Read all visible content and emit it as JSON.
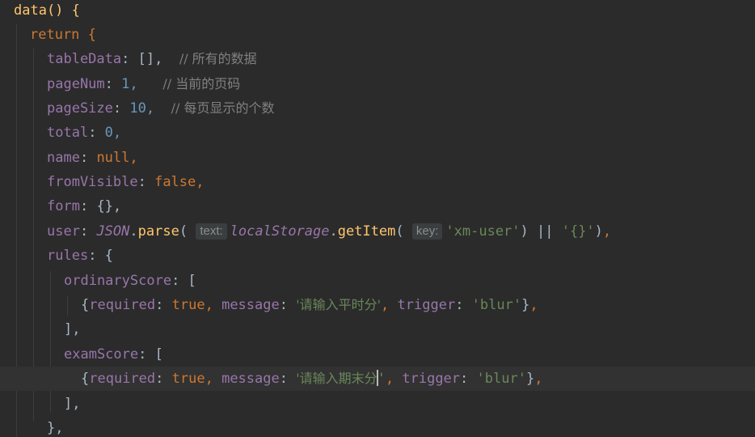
{
  "editor": {
    "lines": [
      {
        "text": "data() {"
      },
      {
        "text": "return {"
      },
      {
        "key": "tableData",
        "value": "[],",
        "comment": "// 所有的数据"
      },
      {
        "key": "pageNum",
        "value": "1,",
        "comment": "// 当前的页码"
      },
      {
        "key": "pageSize",
        "value": "10,",
        "comment": "// 每页显示的个数"
      },
      {
        "key": "total",
        "value": "0,"
      },
      {
        "key": "name",
        "value": "null,"
      },
      {
        "key": "fromVisible",
        "value": "false,"
      },
      {
        "key": "form",
        "value": "{},"
      },
      {
        "key": "user",
        "json": "JSON",
        "parse": "parse",
        "hint_text": "text:",
        "storage": "localStorage",
        "getitem": "getItem",
        "hint_key": "key:",
        "storage_key": "'xm-user'",
        "fallback": "'{}'"
      },
      {
        "key": "rules",
        "value": "{"
      },
      {
        "key": "ordinaryScore",
        "value": "["
      },
      {
        "required": "true",
        "message": "'请输入平时分'",
        "trigger": "'blur'"
      },
      {
        "text": "],"
      },
      {
        "key": "examScore",
        "value": "["
      },
      {
        "required": "true",
        "message_before_caret": "'请输入期末分",
        "message_after_caret": "'",
        "trigger": "'blur'"
      },
      {
        "text": "],"
      },
      {
        "text": "},"
      }
    ]
  }
}
